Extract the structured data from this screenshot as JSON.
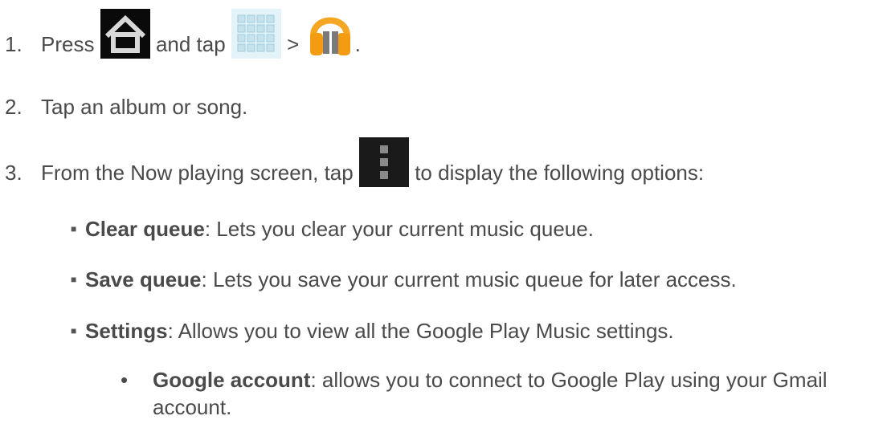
{
  "steps": {
    "s1": {
      "num": "1.",
      "press": "Press",
      "and_tap": "and tap",
      "gt": ">",
      "end": ".",
      "icons": [
        "home-icon",
        "apps-grid-icon",
        "play-music-icon"
      ]
    },
    "s2": {
      "num": "2.",
      "text": "Tap an album or song."
    },
    "s3": {
      "num": "3.",
      "pre": "From the Now playing screen, tap",
      "post": "to display the following options:",
      "icon": "menu-icon"
    }
  },
  "options": [
    {
      "term": "Clear queue",
      "desc": ": Lets you clear your current music queue."
    },
    {
      "term": "Save queue",
      "desc": ": Lets you save your current music queue for later access."
    },
    {
      "term": "Settings",
      "desc": ": Allows you to view all the Google Play Music settings."
    }
  ],
  "sub_options": [
    {
      "term": "Google account",
      "desc": ": allows you to connect to Google Play using your Gmail",
      "desc2": "account."
    }
  ]
}
